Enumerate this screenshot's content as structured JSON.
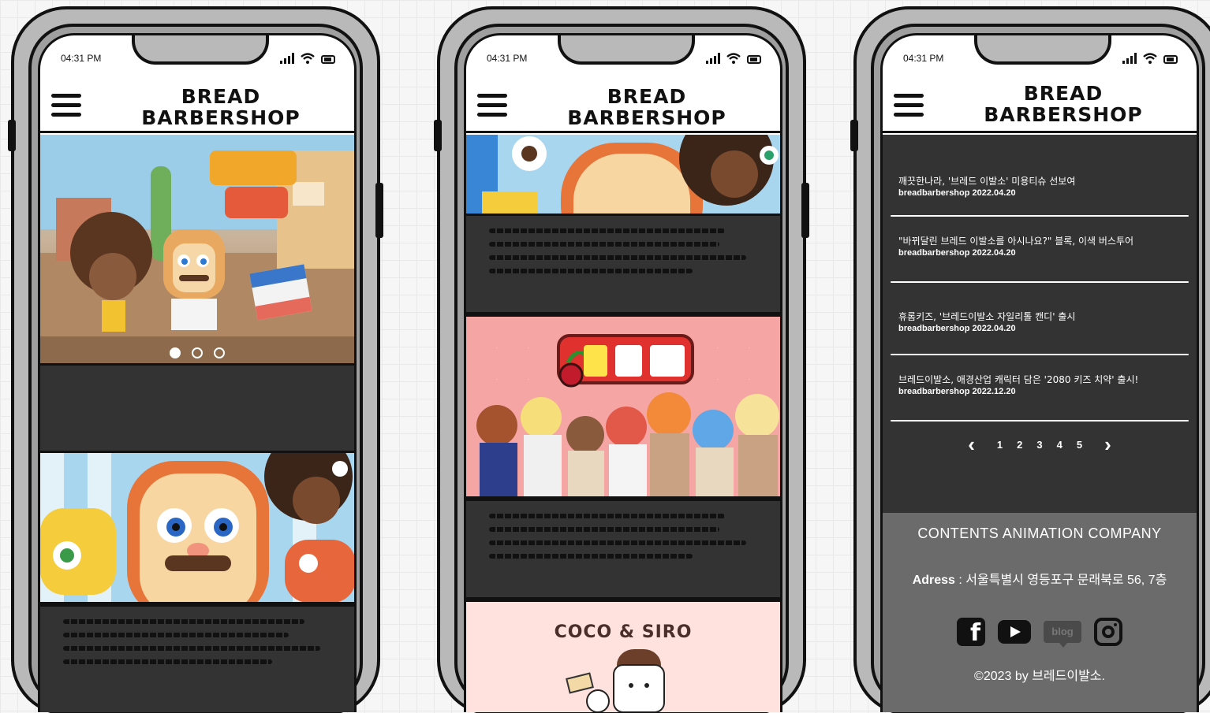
{
  "status_bar": {
    "time": "04:31 PM"
  },
  "header": {
    "brand_line1": "BREAD",
    "brand_line2": "BARBERSHOP"
  },
  "carousel": {
    "slides": 3,
    "active_index": 0
  },
  "phone2": {
    "coco_title": "COCO & SIRO"
  },
  "news": {
    "items": [
      {
        "title": "깨끗한나라, '브레드 이발소' 미용티슈 선보여",
        "meta": "breadbarbershop 2022.04.20"
      },
      {
        "title": "\"바뀌달린 브레드 이발소를 아시나요?\" 블록, 이색 버스투어",
        "meta": "breadbarbershop 2022.04.20"
      },
      {
        "title": "휴롬키즈, '브레드이발소 자일리톨 캔디' 출시",
        "meta": "breadbarbershop 2022.04.20"
      },
      {
        "title": "브레드이발소, 애경산업 캐릭터 담은 '2080 키즈 치약' 출시!",
        "meta": "breadbarbershop 2022.12.20"
      }
    ],
    "pager": {
      "prev": "‹",
      "next": "›",
      "pages": [
        "1",
        "2",
        "3",
        "4",
        "5"
      ]
    }
  },
  "footer": {
    "company": "CONTENTS ANIMATION COMPANY",
    "address_label": "Adress",
    "address_value": " : 서울특별시 영등포구 문래북로 56, 7층",
    "blog_label": "blog",
    "copyright": "©2023 by 브레드이발소."
  },
  "colors": {
    "dark_panel": "#333333",
    "footer": "#6b6b6b",
    "pink_banner": "#f6a5a5",
    "coco_bg": "#ffe1dd"
  }
}
